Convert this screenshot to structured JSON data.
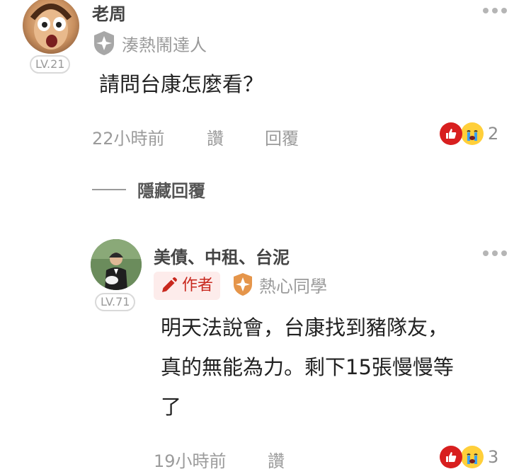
{
  "comment1": {
    "username": "老周",
    "level": "LV.21",
    "title": "湊熱鬧達人",
    "text": "請問台康怎麼看？",
    "time": "22小時前",
    "like_label": "讚",
    "reply_label": "回覆",
    "reaction_count": "2",
    "avatar_icon": "avatar-image"
  },
  "hide_replies_label": "隱藏回覆",
  "comment2": {
    "username": "美債、中租、台泥",
    "level": "LV.71",
    "author_tag": "作者",
    "title": "熱心同學",
    "text_line1": "明天法說會，台康找到豬隊友，",
    "text_line2": "真的無能為力。剩下15張慢慢等",
    "text_line3": "了",
    "time": "19小時前",
    "like_label": "讚",
    "reaction_count": "3"
  },
  "colors": {
    "like_red": "#d81f1f",
    "author_red": "#c8281e",
    "author_bg": "#fdeceb",
    "badge_orange": "#e5954a",
    "badge_gray": "#a7a7a7",
    "muted_text": "#9b9b9b"
  }
}
